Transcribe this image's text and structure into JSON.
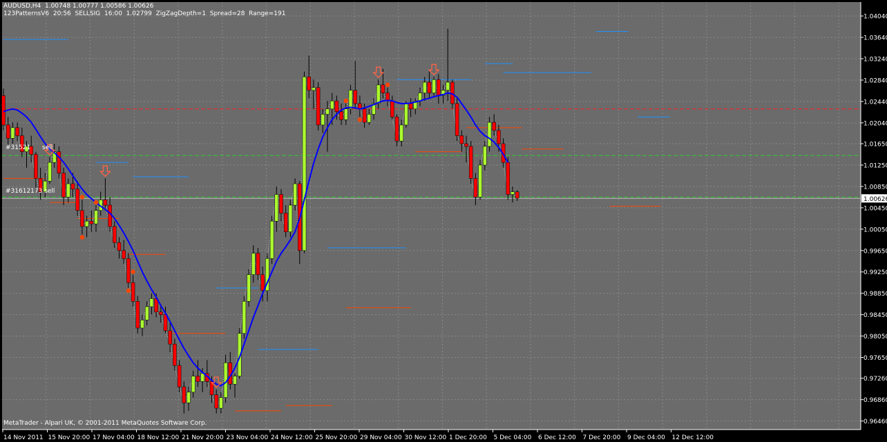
{
  "header": {
    "line1": "AUDUSD,H4  1.00748 1.00777 1.00586 1.00626",
    "line2": "123PatternsV6  20:56  SELLSIG  16:00  1.02799  ZigZagDepth=1  Spread=28  Range=191"
  },
  "trade_labels": [
    "#31521",
    "sell",
    "#31612173 sell"
  ],
  "copyright": "MetaTrader - Alpari UK, © 2001-2011 MetaQuotes Software Corp.",
  "current_price_label": "1.00626",
  "price_axis_labels": [
    "1.04040",
    "1.03640",
    "1.03240",
    "1.02840",
    "1.02440",
    "1.02040",
    "1.01650",
    "1.01250",
    "1.00850",
    "1.00450",
    "1.00050",
    "0.99650",
    "0.99250",
    "0.98850",
    "0.98450",
    "0.98050",
    "0.97650",
    "0.97260",
    "0.96860",
    "0.96460"
  ],
  "time_axis_labels": [
    "14 Nov 2011",
    "15 Nov 20:00",
    "17 Nov 04:00",
    "18 Nov 12:00",
    "21 Nov 20:00",
    "23 Nov 04:00",
    "24 Nov 12:00",
    "25 Nov 20:00",
    "29 Nov 04:00",
    "30 Nov 12:00",
    "1 Dec 20:00",
    "5 Dec 04:00",
    "6 Dec 12:00",
    "7 Dec 20:00",
    "9 Dec 04:00",
    "12 Dec 12:00"
  ],
  "colors": {
    "background": "#6b6b6b",
    "grid": "#8a8a8a",
    "bull_body": "#adff2f",
    "bear_body": "#ff0000",
    "wick": "#000000",
    "ma_line": "#0000ff",
    "resistance_level": "#1e90ff",
    "support_level": "#ff4500",
    "sell_arrow": "#ff6347",
    "pivot_dot": "#ff4500",
    "sell_level_line": "#ff2020",
    "target_line": "#32cd32",
    "bid_line": "#c0c0c0",
    "zigzag": "#ffffff"
  },
  "chart_data": {
    "type": "candlestick",
    "symbol": "AUDUSD",
    "timeframe": "H4",
    "ylim": [
      0.963,
      1.043
    ],
    "bars": [
      [
        1.0255,
        1.0268,
        1.019,
        1.02
      ],
      [
        1.02,
        1.0215,
        1.016,
        1.0175
      ],
      [
        1.0175,
        1.0205,
        1.0165,
        1.0195
      ],
      [
        1.0195,
        1.0205,
        1.017,
        1.018
      ],
      [
        1.018,
        1.0195,
        1.014,
        1.015
      ],
      [
        1.015,
        1.017,
        1.012,
        1.016
      ],
      [
        1.016,
        1.018,
        1.013,
        1.0145
      ],
      [
        1.0145,
        1.015,
        1.008,
        1.01
      ],
      [
        1.01,
        1.012,
        1.006,
        1.0075
      ],
      [
        1.0075,
        1.011,
        1.0065,
        1.0095
      ],
      [
        1.0095,
        1.014,
        1.009,
        1.013
      ],
      [
        1.013,
        1.0165,
        1.012,
        1.015
      ],
      [
        1.015,
        1.016,
        1.01,
        1.011
      ],
      [
        1.011,
        1.012,
        1.005,
        1.0065
      ],
      [
        1.0065,
        1.01,
        1.0055,
        1.009
      ],
      [
        1.009,
        1.011,
        1.0065,
        1.008
      ],
      [
        1.008,
        1.0095,
        1.003,
        1.004
      ],
      [
        1.004,
        1.006,
        0.9995,
        1.001
      ],
      [
        1.001,
        1.003,
        0.999,
        1.002
      ],
      [
        1.002,
        1.004,
        1.0,
        1.0015
      ],
      [
        1.0015,
        1.005,
        1.0,
        1.004
      ],
      [
        1.004,
        1.0075,
        1.003,
        1.006
      ],
      [
        1.006,
        1.01,
        1.004,
        1.005
      ],
      [
        1.005,
        1.0065,
        1.0,
        1.001
      ],
      [
        1.001,
        1.002,
        0.997,
        0.998
      ],
      [
        0.998,
        0.999,
        0.995,
        0.9965
      ],
      [
        0.9965,
        0.9985,
        0.994,
        0.995
      ],
      [
        0.995,
        0.996,
        0.9895,
        0.9905
      ],
      [
        0.9905,
        0.992,
        0.986,
        0.987
      ],
      [
        0.987,
        0.988,
        0.981,
        0.982
      ],
      [
        0.982,
        0.9845,
        0.9805,
        0.9835
      ],
      [
        0.9835,
        0.987,
        0.9825,
        0.986
      ],
      [
        0.986,
        0.9885,
        0.9845,
        0.9875
      ],
      [
        0.9875,
        0.9885,
        0.984,
        0.985
      ],
      [
        0.985,
        0.9865,
        0.983,
        0.9845
      ],
      [
        0.9845,
        0.986,
        0.981,
        0.9815
      ],
      [
        0.9815,
        0.983,
        0.9775,
        0.979
      ],
      [
        0.979,
        0.98,
        0.974,
        0.975
      ],
      [
        0.975,
        0.976,
        0.97,
        0.971
      ],
      [
        0.971,
        0.972,
        0.966,
        0.968
      ],
      [
        0.968,
        0.971,
        0.9665,
        0.97
      ],
      [
        0.97,
        0.974,
        0.969,
        0.973
      ],
      [
        0.973,
        0.976,
        0.971,
        0.972
      ],
      [
        0.972,
        0.9745,
        0.97,
        0.9735
      ],
      [
        0.9735,
        0.976,
        0.971,
        0.972
      ],
      [
        0.972,
        0.973,
        0.968,
        0.9695
      ],
      [
        0.9695,
        0.9705,
        0.966,
        0.967
      ],
      [
        0.967,
        0.97,
        0.966,
        0.969
      ],
      [
        0.969,
        0.977,
        0.968,
        0.9755
      ],
      [
        0.9755,
        0.9775,
        0.9705,
        0.9715
      ],
      [
        0.9715,
        0.9735,
        0.969,
        0.973
      ],
      [
        0.973,
        0.982,
        0.9725,
        0.981
      ],
      [
        0.981,
        0.988,
        0.98,
        0.987
      ],
      [
        0.987,
        0.993,
        0.986,
        0.992
      ],
      [
        0.992,
        0.9975,
        0.9905,
        0.996
      ],
      [
        0.996,
        0.997,
        0.991,
        0.992
      ],
      [
        0.992,
        0.9935,
        0.987,
        0.989
      ],
      [
        0.989,
        0.996,
        0.987,
        0.995
      ],
      [
        0.995,
        1.003,
        0.994,
        1.002
      ],
      [
        1.002,
        1.0085,
        1.0,
        1.007
      ],
      [
        1.007,
        1.008,
        1.002,
        1.0035
      ],
      [
        1.0035,
        1.005,
        0.999,
        1.0
      ],
      [
        1.0,
        1.006,
        0.999,
        1.005
      ],
      [
        1.005,
        1.01,
        1.004,
        1.009
      ],
      [
        1.009,
        1.0095,
        0.994,
        0.9965
      ],
      [
        0.9965,
        1.03,
        0.996,
        1.029
      ],
      [
        1.029,
        1.033,
        1.025,
        1.0265
      ],
      [
        1.0265,
        1.0285,
        1.023,
        1.027
      ],
      [
        1.027,
        1.028,
        1.019,
        1.02
      ],
      [
        1.02,
        1.023,
        1.0185,
        1.022
      ],
      [
        1.022,
        1.0245,
        1.015,
        1.023
      ],
      [
        1.023,
        1.026,
        1.02,
        1.0245
      ],
      [
        1.0245,
        1.0255,
        1.021,
        1.0225
      ],
      [
        1.0225,
        1.024,
        1.02,
        1.021
      ],
      [
        1.021,
        1.024,
        1.02,
        1.023
      ],
      [
        1.023,
        1.0275,
        1.022,
        1.0265
      ],
      [
        1.0265,
        1.032,
        1.023,
        1.024
      ],
      [
        1.024,
        1.0255,
        1.0215,
        1.023
      ],
      [
        1.023,
        1.024,
        1.0195,
        1.0205
      ],
      [
        1.0205,
        1.023,
        1.02,
        1.022
      ],
      [
        1.022,
        1.025,
        1.021,
        1.024
      ],
      [
        1.024,
        1.0285,
        1.023,
        1.0275
      ],
      [
        1.0275,
        1.0305,
        1.025,
        1.026
      ],
      [
        1.026,
        1.027,
        1.0235,
        1.0245
      ],
      [
        1.0245,
        1.0255,
        1.021,
        1.0215
      ],
      [
        1.0215,
        1.022,
        1.016,
        1.017
      ],
      [
        1.017,
        1.021,
        1.016,
        1.02
      ],
      [
        1.02,
        1.0245,
        1.0195,
        1.024
      ],
      [
        1.024,
        1.025,
        1.0215,
        1.023
      ],
      [
        1.023,
        1.025,
        1.022,
        1.0245
      ],
      [
        1.0245,
        1.027,
        1.0235,
        1.026
      ],
      [
        1.026,
        1.029,
        1.0245,
        1.028
      ],
      [
        1.028,
        1.03,
        1.025,
        1.026
      ],
      [
        1.026,
        1.029,
        1.0255,
        1.0285
      ],
      [
        1.0285,
        1.0295,
        1.024,
        1.0255
      ],
      [
        1.0255,
        1.0275,
        1.024,
        1.0265
      ],
      [
        1.0265,
        1.038,
        1.0245,
        1.028
      ],
      [
        1.028,
        1.0285,
        1.023,
        1.024
      ],
      [
        1.024,
        1.025,
        1.017,
        1.018
      ],
      [
        1.018,
        1.019,
        1.015,
        1.0165
      ],
      [
        1.0165,
        1.018,
        1.013,
        1.016
      ],
      [
        1.016,
        1.017,
        1.009,
        1.01
      ],
      [
        1.01,
        1.011,
        1.005,
        1.0065
      ],
      [
        1.0065,
        1.0135,
        1.006,
        1.0125
      ],
      [
        1.0125,
        1.017,
        1.0115,
        1.016
      ],
      [
        1.016,
        1.0215,
        1.015,
        1.0205
      ],
      [
        1.0205,
        1.022,
        1.018,
        1.019
      ],
      [
        1.019,
        1.02,
        1.015,
        1.0165
      ],
      [
        1.0165,
        1.0175,
        1.012,
        1.013
      ],
      [
        1.013,
        1.014,
        1.006,
        1.007
      ],
      [
        1.007,
        1.0085,
        1.0055,
        1.0075
      ],
      [
        1.0075,
        1.0078,
        1.0058,
        1.0063
      ]
    ],
    "moving_average": [
      1.0225,
      1.0228,
      1.023,
      1.0228,
      1.0222,
      1.0215,
      1.0205,
      1.0192,
      1.0178,
      1.0165,
      1.0155,
      1.0148,
      1.014,
      1.013,
      1.0118,
      1.0105,
      1.0092,
      1.008,
      1.007,
      1.0062,
      1.0055,
      1.0048,
      1.0042,
      1.0035,
      1.0025,
      1.0012,
      0.9998,
      0.9982,
      0.9965,
      0.9945,
      0.9925,
      0.9908,
      0.9892,
      0.9878,
      0.9862,
      0.9848,
      0.9832,
      0.9815,
      0.9798,
      0.9782,
      0.9768,
      0.9755,
      0.9745,
      0.9737,
      0.973,
      0.9722,
      0.9715,
      0.9712,
      0.9718,
      0.973,
      0.9745,
      0.9765,
      0.979,
      0.9815,
      0.984,
      0.9862,
      0.9885,
      0.9905,
      0.9925,
      0.9945,
      0.996,
      0.9972,
      0.9985,
      1.0,
      1.0025,
      1.006,
      1.0095,
      1.0128,
      1.0155,
      1.0178,
      1.0195,
      1.021,
      1.022,
      1.0228,
      1.0232,
      1.0233,
      1.0232,
      1.023,
      1.0232,
      1.0235,
      1.0238,
      1.0242,
      1.0245,
      1.0246,
      1.0245,
      1.0242,
      1.024,
      1.024,
      1.0241,
      1.0243,
      1.0245,
      1.0248,
      1.025,
      1.0253,
      1.0255,
      1.0257,
      1.026,
      1.0258,
      1.0252,
      1.024,
      1.0228,
      1.0215,
      1.02,
      1.0188,
      1.018,
      1.0175,
      1.0168,
      1.0158,
      1.0145,
      1.013
    ],
    "sell_arrow_bars": [
      10,
      22,
      46,
      81,
      93
    ],
    "pivot_high_bars": [
      17,
      20,
      28,
      74,
      83
    ],
    "pivot_low_bars": [
      17,
      27,
      77
    ],
    "resistance_levels": [
      {
        "price": 1.036,
        "start": 0,
        "end": 14
      },
      {
        "price": 1.013,
        "start": 20,
        "end": 27
      },
      {
        "price": 1.0103,
        "start": 28,
        "end": 40
      },
      {
        "price": 0.9895,
        "start": 46,
        "end": 55
      },
      {
        "price": 0.978,
        "start": 55,
        "end": 68
      },
      {
        "price": 0.997,
        "start": 70,
        "end": 87
      },
      {
        "price": 1.0285,
        "start": 85,
        "end": 101
      },
      {
        "price": 1.0315,
        "start": 104,
        "end": 110
      },
      {
        "price": 1.0298,
        "start": 108,
        "end": 127
      },
      {
        "price": 1.0375,
        "start": 128,
        "end": 135
      },
      {
        "price": 1.0215,
        "start": 137,
        "end": 144
      }
    ],
    "support_levels": [
      {
        "price": 1.01,
        "start": 0,
        "end": 9
      },
      {
        "price": 1.0055,
        "start": 10,
        "end": 16
      },
      {
        "price": 1.0025,
        "start": 16,
        "end": 25
      },
      {
        "price": 0.9958,
        "start": 27,
        "end": 35
      },
      {
        "price": 0.981,
        "start": 36,
        "end": 48
      },
      {
        "price": 0.9665,
        "start": 50,
        "end": 60
      },
      {
        "price": 0.9675,
        "start": 61,
        "end": 71
      },
      {
        "price": 0.9858,
        "start": 74,
        "end": 88
      },
      {
        "price": 1.015,
        "start": 89,
        "end": 99
      },
      {
        "price": 1.0195,
        "start": 100,
        "end": 112
      },
      {
        "price": 1.0155,
        "start": 112,
        "end": 121
      },
      {
        "price": 1.0048,
        "start": 131,
        "end": 142
      }
    ],
    "sell_level": 1.023,
    "target_levels": [
      1.0143,
      1.0065
    ],
    "bid": 1.00626
  }
}
